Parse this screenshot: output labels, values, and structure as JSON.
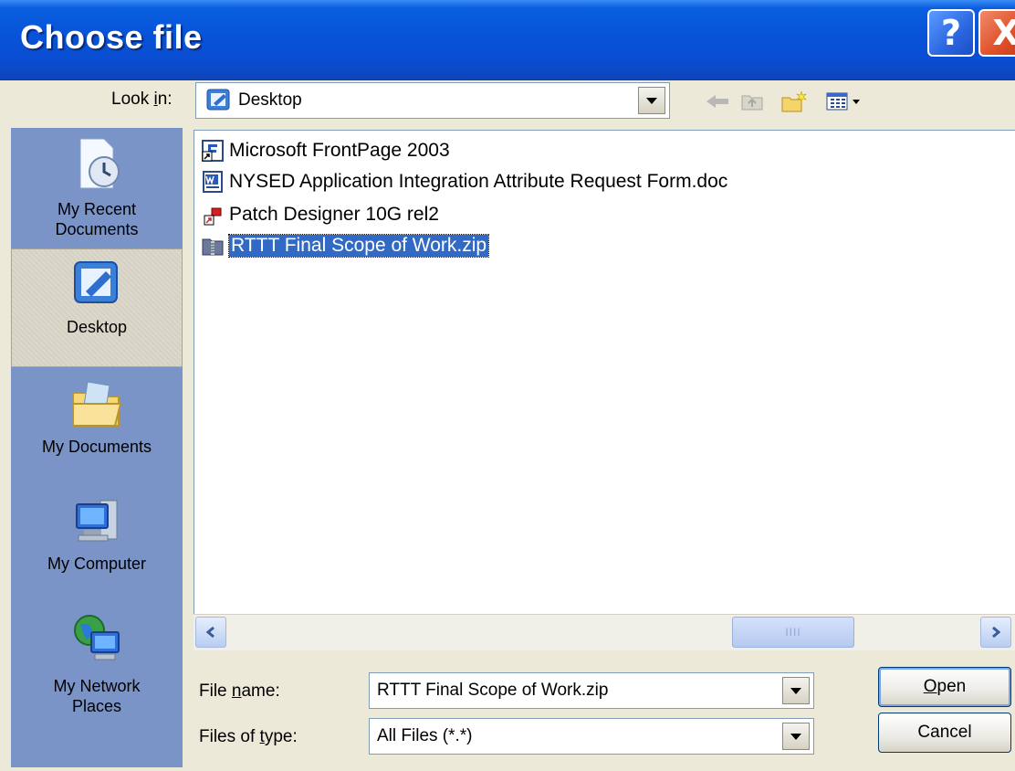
{
  "window": {
    "title": "Choose file",
    "help_label": "?",
    "close_label": "X"
  },
  "lookin": {
    "label_pre": "Look ",
    "label_ul": "i",
    "label_post": "n:",
    "value": "Desktop"
  },
  "places": [
    {
      "label_line1": "My Recent",
      "label_line2": "Documents",
      "icon": "recent-documents-icon"
    },
    {
      "label_line1": "Desktop",
      "label_line2": "",
      "icon": "desktop-icon"
    },
    {
      "label_line1": "My Documents",
      "label_line2": "",
      "icon": "my-documents-icon"
    },
    {
      "label_line1": "My Computer",
      "label_line2": "",
      "icon": "my-computer-icon"
    },
    {
      "label_line1": "My Network",
      "label_line2": "Places",
      "icon": "network-places-icon"
    }
  ],
  "files": [
    {
      "name": "Microsoft FrontPage 2003",
      "icon": "frontpage-shortcut-icon"
    },
    {
      "name": "NYSED Application Integration Attribute Request Form.doc",
      "icon": "word-document-icon"
    },
    {
      "name": "Patch Designer 10G rel2",
      "icon": "app-shortcut-icon"
    },
    {
      "name": "RTTT Final Scope of Work.zip",
      "icon": "zip-folder-icon"
    }
  ],
  "scrollbar": {
    "grip": "IIII"
  },
  "filename": {
    "label_pre": "File ",
    "label_ul": "n",
    "label_post": "ame:",
    "value": "RTTT Final Scope of Work.zip"
  },
  "filetype": {
    "label_pre": "Files of ",
    "label_ul": "t",
    "label_post": "ype:",
    "value": "All Files (*.*)"
  },
  "buttons": {
    "open_ul": "O",
    "open_rest": "pen",
    "cancel": "Cancel"
  },
  "colors": {
    "titlebar": "#0753d8",
    "selection": "#316ac5",
    "places_bar": "#7a94c8"
  }
}
